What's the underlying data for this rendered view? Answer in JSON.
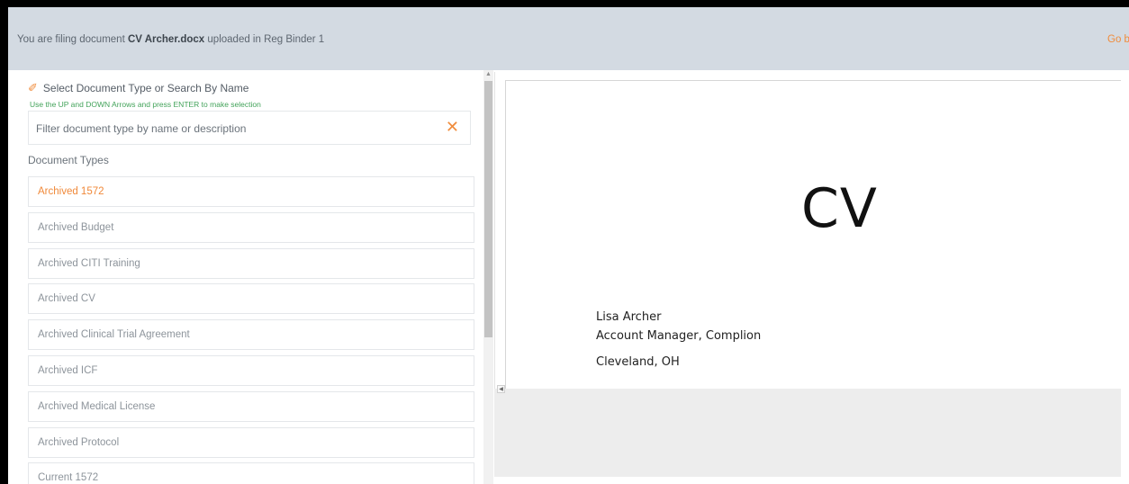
{
  "banner": {
    "prefix": "You are filing document",
    "filename": "CV Archer.docx",
    "suffix": "uploaded in Reg Binder 1",
    "go_back": "Go back"
  },
  "selector": {
    "heading": "Select Document Type or Search By Name",
    "hint": "Use the UP and DOWN Arrows and press ENTER to make selection",
    "filter_placeholder": "Filter document type by name or description",
    "filter_value": "",
    "clear_icon": "close-x-icon",
    "doc_types_label": "Document Types"
  },
  "document_types": [
    {
      "label": "Archived 1572",
      "active": true
    },
    {
      "label": "Archived Budget",
      "active": false
    },
    {
      "label": "Archived CITI Training",
      "active": false
    },
    {
      "label": "Archived CV",
      "active": false
    },
    {
      "label": "Archived Clinical Trial Agreement",
      "active": false
    },
    {
      "label": "Archived ICF",
      "active": false
    },
    {
      "label": "Archived Medical License",
      "active": false
    },
    {
      "label": "Archived Protocol",
      "active": false
    },
    {
      "label": "Current 1572",
      "active": false
    }
  ],
  "preview": {
    "title": "CV",
    "name": "Lisa Archer",
    "role": "Account Manager, Complion",
    "location": "Cleveland, OH"
  },
  "colors": {
    "accent": "#f08c3c",
    "banner_bg": "#d3dae2",
    "hint_green": "#43a35a"
  }
}
